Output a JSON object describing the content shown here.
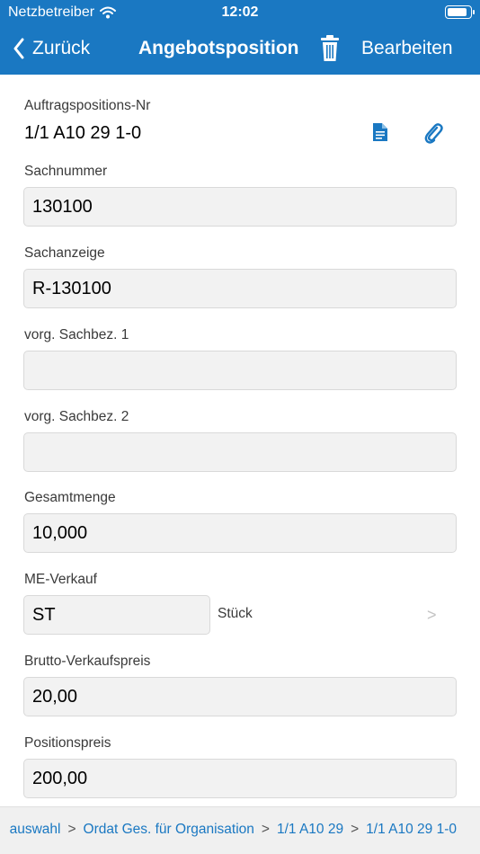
{
  "status_bar": {
    "carrier": "Netzbetreiber",
    "time": "12:02",
    "battery_level": 0.9
  },
  "nav": {
    "back_label": "Zurück",
    "title": "Angebotsposition",
    "edit_label": "Bearbeiten",
    "icons": {
      "back": "chevron-left-icon",
      "delete": "trash-icon"
    }
  },
  "order_position": {
    "label": "Auftragspositions-Nr",
    "value": "1/1 A10 29 1-0",
    "icons": {
      "document": "document-icon",
      "attachment": "paperclip-icon"
    }
  },
  "fields": {
    "sachnummer": {
      "label": "Sachnummer",
      "value": "130100"
    },
    "sachanzeige": {
      "label": "Sachanzeige",
      "value": "R-130100"
    },
    "sachbez1": {
      "label": "vorg. Sachbez. 1",
      "value": ""
    },
    "sachbez2": {
      "label": "vorg. Sachbez. 2",
      "value": ""
    },
    "gesamtmenge": {
      "label": "Gesamtmenge",
      "value": "10,000"
    },
    "me_verkauf": {
      "label": "ME-Verkauf",
      "value": "ST",
      "unit_text": "Stück",
      "chevron": ">"
    },
    "brutto": {
      "label": "Brutto-Verkaufspreis",
      "value": "20,00"
    },
    "positionspreis": {
      "label": "Positionspreis",
      "value": "200,00"
    }
  },
  "breadcrumb": {
    "separator": ">",
    "items": [
      "auswahl",
      "Ordat Ges. für Organisation",
      "1/1 A10 29",
      "1/1 A10 29 1-0"
    ]
  },
  "colors": {
    "header": "#1a78c2",
    "accent": "#1a78c2",
    "field_bg": "#f2f2f2",
    "breadcrumb_bg": "#f0f0f0"
  }
}
